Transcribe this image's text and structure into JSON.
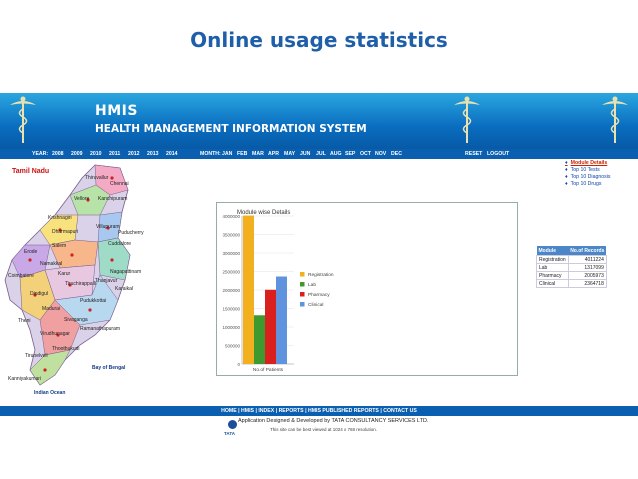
{
  "slide": {
    "title": "Online usage statistics"
  },
  "header": {
    "app_name": "HMIS",
    "app_subtitle": "HEALTH MANAGEMENT INFORMATION SYSTEM"
  },
  "nav": {
    "year_label": "YEAR:",
    "years": [
      "2008",
      "2009",
      "2010",
      "2011",
      "2012",
      "2013",
      "2014"
    ],
    "month_label": "MONTH:",
    "months": [
      "JAN",
      "FEB",
      "MAR",
      "APR",
      "MAY",
      "JUN",
      "JUL",
      "AUG",
      "SEP",
      "OCT",
      "NOV",
      "DEC"
    ],
    "reset": "RESET",
    "logout": "LOGOUT"
  },
  "map": {
    "title": "Tamil Nadu",
    "districts": [
      "Chennai",
      "Thiruvallur",
      "Kanchipuram",
      "Vellore",
      "Krishnagiri",
      "Dharmapuri",
      "Salem",
      "Erode",
      "Coimbatore",
      "Namakkal",
      "Karur",
      "Tiruchirappalli",
      "Thanjavur",
      "Nagapattinam",
      "Pudukkottai",
      "Madurai",
      "Dindigul",
      "Theni",
      "Virudhunagar",
      "Ramanathapuram",
      "Sivaganga",
      "Tirunelveli",
      "Thoothukudi",
      "Kanniyakumari",
      "Puducherry",
      "Cuddalore",
      "Villupuram",
      "Karaikal"
    ],
    "sea_label": "Bay of Bengal",
    "ocean_label": "Indian Ocean"
  },
  "right_links": [
    {
      "label": "Module Details",
      "active": true
    },
    {
      "label": "Top 10 Tests",
      "active": false
    },
    {
      "label": "Top 10 Diagnosis",
      "active": false
    },
    {
      "label": "Top 10 Drugs",
      "active": false
    }
  ],
  "stats_table": {
    "headers": [
      "Module",
      "No.of Records"
    ],
    "rows": [
      [
        "Registration",
        "4011224"
      ],
      [
        "Lab",
        "1317099"
      ],
      [
        "Pharmacy",
        "2005973"
      ],
      [
        "Clinical",
        "2364718"
      ]
    ]
  },
  "chart_data": {
    "type": "bar",
    "title": "Module wise Details",
    "categories": [
      "No.of Patients"
    ],
    "xlabel": "No.of Patients",
    "ylim": [
      0,
      4000000
    ],
    "yticks": [
      "0",
      "500000",
      "1000000",
      "1500000",
      "2000000",
      "2500000",
      "3000000",
      "3500000",
      "4000000"
    ],
    "grid": true,
    "legend_position": "right",
    "series": [
      {
        "name": "Registration",
        "values": [
          4011224
        ],
        "color": "#f2b01e"
      },
      {
        "name": "Lab",
        "values": [
          1317099
        ],
        "color": "#3e9a2e"
      },
      {
        "name": "Pharmacy",
        "values": [
          2005973
        ],
        "color": "#d9201e"
      },
      {
        "name": "Clinical",
        "values": [
          2364718
        ],
        "color": "#5f93de"
      }
    ]
  },
  "footer": {
    "links": [
      "HOME",
      "HMIS",
      "INDEX",
      "REPORTS",
      "HMIS PUBLISHED REPORTS",
      "CONTACT US"
    ],
    "credit": "Application Designed & Developed by TATA CONSULTANCY SERVICES LTD.",
    "note": "This site can be best viewed at 1024 x 768 resolution.",
    "logo_text": "TATA"
  }
}
